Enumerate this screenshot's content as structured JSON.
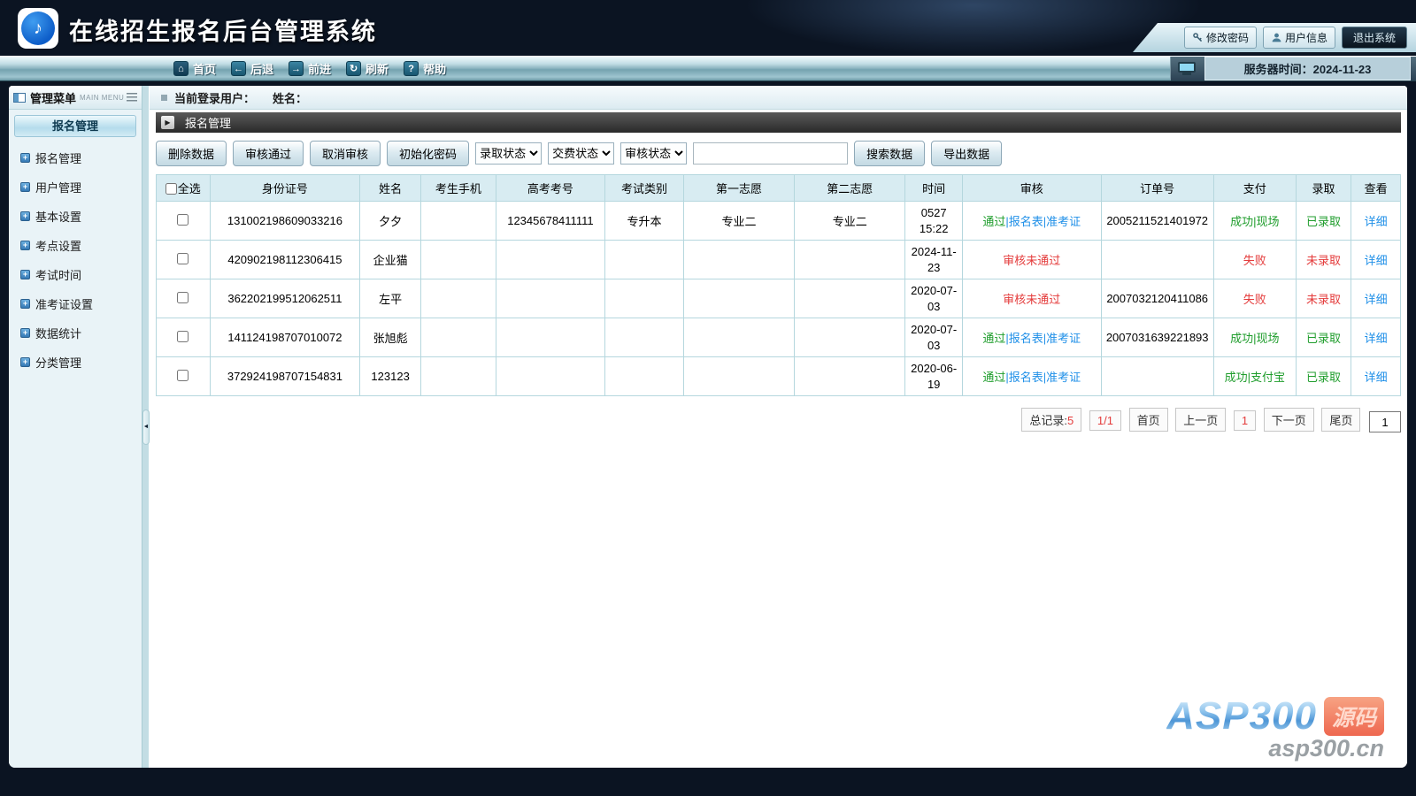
{
  "header": {
    "title": "在线招生报名后台管理系统",
    "change_password": "修改密码",
    "user_info": "用户信息",
    "logout": "退出系统"
  },
  "navbar": {
    "items": [
      {
        "label": "首页"
      },
      {
        "label": "后退"
      },
      {
        "label": "前进"
      },
      {
        "label": "刷新"
      },
      {
        "label": "帮助"
      }
    ],
    "server_time": "服务器时间：2024-11-23"
  },
  "sidebar": {
    "title": "管理菜单",
    "subtitle": "MAIN MENU",
    "group": "报名管理",
    "items": [
      "报名管理",
      "用户管理",
      "基本设置",
      "考点设置",
      "考试时间",
      "准考证设置",
      "数据统计",
      "分类管理"
    ]
  },
  "main": {
    "login_label": "当前登录用户：",
    "name_label": "姓名：",
    "section_title": "报名管理",
    "toolbar": {
      "delete": "删除数据",
      "approve": "审核通过",
      "cancel": "取消审核",
      "reset_pwd": "初始化密码",
      "select_admission": "录取状态",
      "select_payment": "交费状态",
      "select_audit": "审核状态",
      "search_value": "",
      "search": "搜索数据",
      "export": "导出数据"
    },
    "table": {
      "select_all": "全选",
      "headers": [
        "身份证号",
        "姓名",
        "考生手机",
        "高考考号",
        "考试类别",
        "第一志愿",
        "第二志愿",
        "时间",
        "审核",
        "订单号",
        "支付",
        "录取",
        "查看"
      ],
      "rows": [
        {
          "id": "131002198609033216",
          "name": "夕夕",
          "phone": "",
          "exam_no": "12345678411111",
          "category": "专升本",
          "choice1": "专业二",
          "choice2": "专业二",
          "time": "0527\n15:22",
          "audit": [
            {
              "t": "通过",
              "c": "green"
            },
            {
              "t": "|",
              "c": "blue"
            },
            {
              "t": "报名表",
              "c": "blue"
            },
            {
              "t": "|",
              "c": "blue"
            },
            {
              "t": "准考证",
              "c": "blue"
            }
          ],
          "order": "2005211521401972",
          "pay": [
            {
              "t": "成功|现场",
              "c": "green"
            }
          ],
          "admit": {
            "t": "已录取",
            "c": "green"
          },
          "view": "详细"
        },
        {
          "id": "420902198112306415",
          "name": "企业猫",
          "phone": "",
          "exam_no": "",
          "category": "",
          "choice1": "",
          "choice2": "",
          "time": "2024-11-\n23",
          "audit": [
            {
              "t": "审核未通过",
              "c": "red"
            }
          ],
          "order": "",
          "pay": [
            {
              "t": "失败",
              "c": "red"
            }
          ],
          "admit": {
            "t": "未录取",
            "c": "red"
          },
          "view": "详细"
        },
        {
          "id": "362202199512062511",
          "name": "左平",
          "phone": "",
          "exam_no": "",
          "category": "",
          "choice1": "",
          "choice2": "",
          "time": "2020-07-\n03",
          "audit": [
            {
              "t": "审核未通过",
              "c": "red"
            }
          ],
          "order": "2007032120411086",
          "pay": [
            {
              "t": "失败",
              "c": "red"
            }
          ],
          "admit": {
            "t": "未录取",
            "c": "red"
          },
          "view": "详细"
        },
        {
          "id": "141124198707010072",
          "name": "张旭彪",
          "phone": "",
          "exam_no": "",
          "category": "",
          "choice1": "",
          "choice2": "",
          "time": "2020-07-\n03",
          "audit": [
            {
              "t": "通过",
              "c": "green"
            },
            {
              "t": "|",
              "c": "blue"
            },
            {
              "t": "报名表",
              "c": "blue"
            },
            {
              "t": "|",
              "c": "blue"
            },
            {
              "t": "准考证",
              "c": "blue"
            }
          ],
          "order": "2007031639221893",
          "pay": [
            {
              "t": "成功|现场",
              "c": "green"
            }
          ],
          "admit": {
            "t": "已录取",
            "c": "green"
          },
          "view": "详细"
        },
        {
          "id": "372924198707154831",
          "name": "123123",
          "phone": "",
          "exam_no": "",
          "category": "",
          "choice1": "",
          "choice2": "",
          "time": "2020-06-\n19",
          "audit": [
            {
              "t": "通过",
              "c": "green"
            },
            {
              "t": "|",
              "c": "blue"
            },
            {
              "t": "报名表",
              "c": "blue"
            },
            {
              "t": "|",
              "c": "blue"
            },
            {
              "t": "准考证",
              "c": "blue"
            }
          ],
          "order": "",
          "pay": [
            {
              "t": "成功|支付宝",
              "c": "green"
            }
          ],
          "admit": {
            "t": "已录取",
            "c": "green"
          },
          "view": "详细"
        }
      ]
    },
    "pagination": {
      "total_label": "总记录:",
      "total": "5",
      "ratio": "1/1",
      "first": "首页",
      "prev": "上一页",
      "current": "1",
      "next": "下一页",
      "last": "尾页",
      "input_value": "1"
    }
  },
  "watermark": {
    "brand": "ASP300",
    "badge": "源码",
    "site": "asp300.cn"
  },
  "colors": {
    "status_green": "#1f9d2c",
    "status_red": "#e43b3b",
    "link_blue": "#2090e8"
  }
}
